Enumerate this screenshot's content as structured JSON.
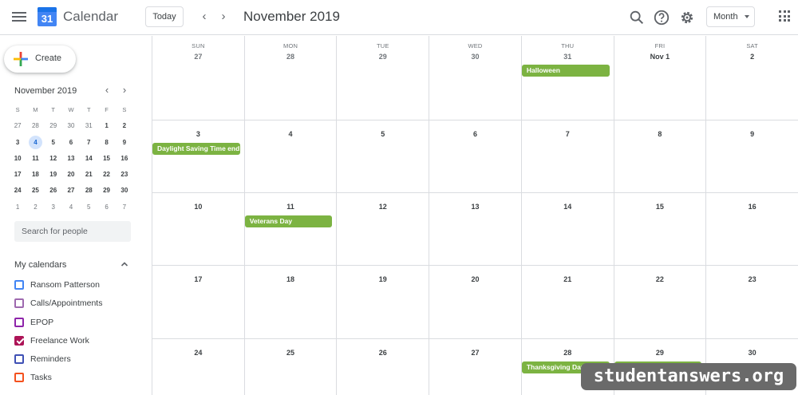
{
  "header": {
    "app_title": "Calendar",
    "logo_day": "31",
    "today_label": "Today",
    "month_title": "November 2019",
    "view_label": "Month"
  },
  "sidebar": {
    "create_label": "Create",
    "mini_title": "November 2019",
    "weekdays": [
      "S",
      "M",
      "T",
      "W",
      "T",
      "F",
      "S"
    ],
    "mini_weeks": [
      [
        "27",
        "28",
        "29",
        "30",
        "31",
        "1",
        "2"
      ],
      [
        "3",
        "4",
        "5",
        "6",
        "7",
        "8",
        "9"
      ],
      [
        "10",
        "11",
        "12",
        "13",
        "14",
        "15",
        "16"
      ],
      [
        "17",
        "18",
        "19",
        "20",
        "21",
        "22",
        "23"
      ],
      [
        "24",
        "25",
        "26",
        "27",
        "28",
        "29",
        "30"
      ],
      [
        "1",
        "2",
        "3",
        "4",
        "5",
        "6",
        "7"
      ]
    ],
    "search_placeholder": "Search for people",
    "my_calendars_title": "My calendars",
    "calendars": [
      {
        "name": "Ransom Patterson",
        "color": "#4285f4",
        "checked": false
      },
      {
        "name": "Calls/Appointments",
        "color": "#9e69af",
        "checked": false
      },
      {
        "name": "EPOP",
        "color": "#8e24aa",
        "checked": false
      },
      {
        "name": "Freelance Work",
        "color": "#ad1457",
        "checked": true
      },
      {
        "name": "Reminders",
        "color": "#3f51b5",
        "checked": false
      },
      {
        "name": "Tasks",
        "color": "#f4511e",
        "checked": false
      }
    ]
  },
  "grid": {
    "day_names": [
      "SUN",
      "MON",
      "TUE",
      "WED",
      "THU",
      "FRI",
      "SAT"
    ],
    "weeks": [
      [
        "27",
        "28",
        "29",
        "30",
        "31",
        "Nov 1",
        "2"
      ],
      [
        "3",
        "4",
        "5",
        "6",
        "7",
        "8",
        "9"
      ],
      [
        "10",
        "11",
        "12",
        "13",
        "14",
        "15",
        "16"
      ],
      [
        "17",
        "18",
        "19",
        "20",
        "21",
        "22",
        "23"
      ],
      [
        "24",
        "25",
        "26",
        "27",
        "28",
        "29",
        "30"
      ]
    ],
    "events": [
      {
        "title": "Halloween",
        "week": 0,
        "day": 4
      },
      {
        "title": "Daylight Saving Time end",
        "week": 1,
        "day": 0
      },
      {
        "title": "Veterans Day",
        "week": 2,
        "day": 1
      },
      {
        "title": "Thanksgiving Day",
        "week": 4,
        "day": 4
      },
      {
        "title": "Black Friday",
        "week": 4,
        "day": 5
      }
    ]
  },
  "colors": {
    "event_green": "#7cb342",
    "today_highlight": "#d2e3fc",
    "logo_blue": "#4285f4"
  },
  "watermark": "studentanswers.org"
}
